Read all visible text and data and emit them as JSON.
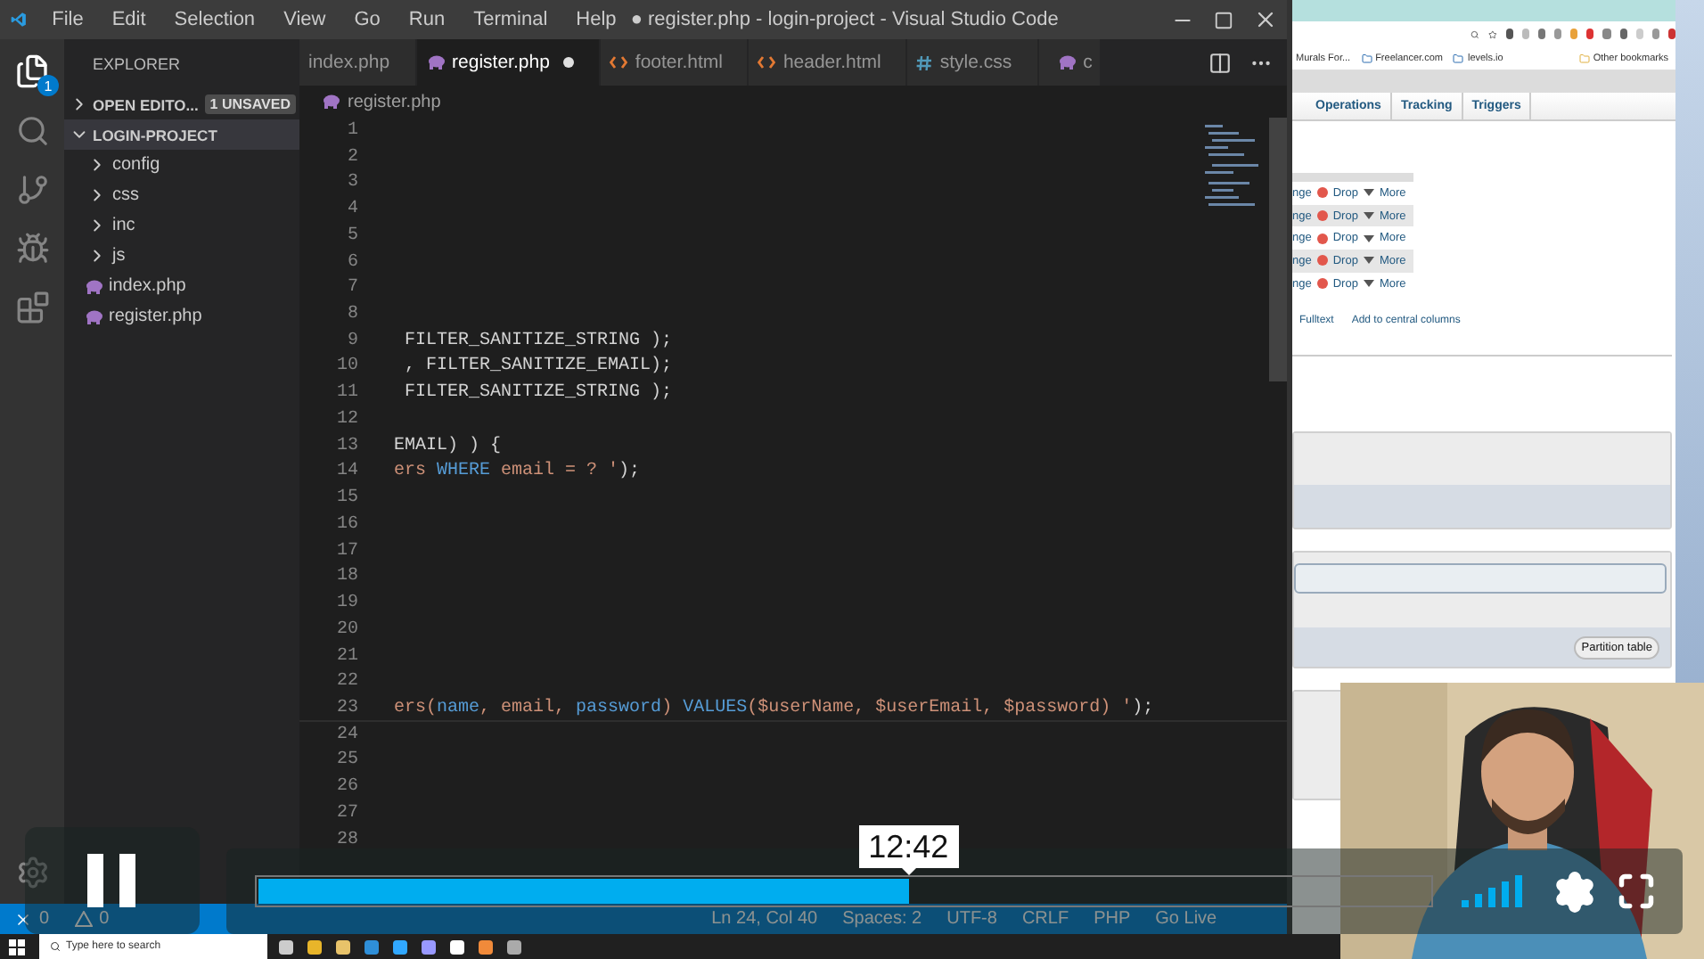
{
  "vscode": {
    "menu": [
      "File",
      "Edit",
      "Selection",
      "View",
      "Go",
      "Run",
      "Terminal",
      "Help"
    ],
    "title": "● register.php - login-project - Visual Studio Code",
    "activity_badge": "1",
    "sidebar": {
      "title": "EXPLORER",
      "sections": [
        {
          "label": "OPEN EDITO...",
          "badge": "1 UNSAVED",
          "expanded": false
        },
        {
          "label": "LOGIN-PROJECT",
          "expanded": true
        }
      ],
      "items": [
        {
          "kind": "folder",
          "label": "config"
        },
        {
          "kind": "folder",
          "label": "css"
        },
        {
          "kind": "folder",
          "label": "inc"
        },
        {
          "kind": "folder",
          "label": "js"
        },
        {
          "kind": "php",
          "label": "index.php"
        },
        {
          "kind": "php",
          "label": "register.php"
        }
      ]
    },
    "tabs": [
      {
        "label": "index.php",
        "kind": "none",
        "selected": false,
        "dirty": false
      },
      {
        "label": "register.php",
        "kind": "php",
        "selected": true,
        "dirty": true
      },
      {
        "label": "footer.html",
        "kind": "html",
        "selected": false,
        "dirty": false
      },
      {
        "label": "header.html",
        "kind": "html",
        "selected": false,
        "dirty": false
      },
      {
        "label": "style.css",
        "kind": "css",
        "selected": false,
        "dirty": false
      },
      {
        "label": "c",
        "kind": "php",
        "selected": false,
        "dirty": false
      }
    ],
    "breadcrumb": "register.php",
    "code_lines": [
      {
        "number": "1"
      },
      {
        "number": "2"
      },
      {
        "number": "3"
      },
      {
        "number": "4"
      },
      {
        "number": "5"
      },
      {
        "number": "6"
      },
      {
        "number": "7"
      },
      {
        "number": "8"
      },
      {
        "number": "9",
        "tokens": [
          {
            "text": " FILTER_SANITIZE_STRING );",
            "kind": "plain"
          }
        ]
      },
      {
        "number": "10",
        "tokens": [
          {
            "text": " , FILTER_SANITIZE_EMAIL);",
            "kind": "plain"
          }
        ]
      },
      {
        "number": "11",
        "tokens": [
          {
            "text": " FILTER_SANITIZE_STRING );",
            "kind": "plain"
          }
        ]
      },
      {
        "number": "12"
      },
      {
        "number": "13",
        "tokens": [
          {
            "text": "EMAIL) ) {",
            "kind": "plain"
          }
        ]
      },
      {
        "number": "14",
        "tokens": [
          {
            "text": "ers ",
            "kind": "string"
          },
          {
            "text": "WHERE",
            "kind": "keyword"
          },
          {
            "text": " email = ? '",
            "kind": "string"
          },
          {
            "text": ");",
            "kind": "plain"
          }
        ]
      },
      {
        "number": "15"
      },
      {
        "number": "16"
      },
      {
        "number": "17"
      },
      {
        "number": "18"
      },
      {
        "number": "19"
      },
      {
        "number": "20"
      },
      {
        "number": "21"
      },
      {
        "number": "22"
      },
      {
        "number": "23",
        "tokens": [
          {
            "text": "ers(",
            "kind": "string"
          },
          {
            "text": "name",
            "kind": "keyword"
          },
          {
            "text": ", email, ",
            "kind": "string"
          },
          {
            "text": "password",
            "kind": "keyword"
          },
          {
            "text": ") ",
            "kind": "string"
          },
          {
            "text": "VALUES",
            "kind": "keyword"
          },
          {
            "text": "($userName, $userEmail, $password) '",
            "kind": "string"
          },
          {
            "text": ");",
            "kind": "plain"
          }
        ]
      },
      {
        "number": "24"
      },
      {
        "number": "25"
      },
      {
        "number": "26"
      },
      {
        "number": "27"
      },
      {
        "number": "28"
      }
    ],
    "status_bar": {
      "errors": "0",
      "warnings": "0",
      "items": [
        "Ln 24, Col 40",
        "Spaces: 2",
        "UTF-8",
        "CRLF",
        "PHP",
        "Go Live"
      ]
    }
  },
  "browser": {
    "bookmarks": [
      "Murals For...",
      "Freelancer.com",
      "levels.io",
      "Other bookmarks"
    ],
    "tabs": [
      "Operations",
      "Tracking",
      "Triggers"
    ],
    "rows": [
      {
        "change": "nge",
        "drop": "Drop",
        "more": "More",
        "shaded": false
      },
      {
        "change": "nge",
        "drop": "Drop",
        "more": "More",
        "shaded": true
      },
      {
        "change": "nge",
        "drop": "Drop",
        "more": "More",
        "shaded": false
      },
      {
        "change": "nge",
        "drop": "Drop",
        "more": "More",
        "shaded": true
      },
      {
        "change": "nge",
        "drop": "Drop",
        "more": "More",
        "shaded": false
      }
    ],
    "links": [
      "Fulltext",
      "Add to central columns"
    ],
    "partition_button": "Partition table"
  },
  "taskbar": {
    "search_placeholder": "Type here to search"
  },
  "player": {
    "playing": true,
    "level": 0.555,
    "time_tooltip": "12:42"
  }
}
